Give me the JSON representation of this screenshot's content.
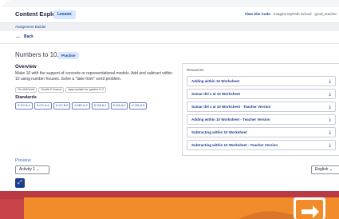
{
  "header": {
    "app_title": "Content Explorer",
    "badge": "Lesson",
    "view_site_code": "View Site Code",
    "school_text": "· Imagine MyPath School · good_teacher"
  },
  "breadcrumb": {
    "label": "Assignment Builder"
  },
  "nav": {
    "back_arrow": "←",
    "back_label": "Back"
  },
  "lesson": {
    "title": "Numbers to 10, I",
    "type_badge": "Practice",
    "overview_heading": "Overview",
    "overview_text": "Make 10 with the support of concrete or representational models. Add and subtract within 10 using number houses. Solve a \"take from\" word problem.",
    "chips": [
      "On skill level",
      "Grade K lesson",
      "Appropriate for grades K-2"
    ],
    "standards_heading": "Standards",
    "standards": [
      "K.CC.A.1",
      "K.CC.A.2",
      "K.CC.B.5",
      "K.MD.A.2",
      "K.OA.A.1",
      "K.OA.A.2",
      "K.OA.A.3"
    ]
  },
  "resources": {
    "heading": "Resources",
    "download_icon": "download-icon",
    "items": [
      "Adding within 10 Worksheet",
      "Sumar del 1 al 10 Worksheet",
      "Sumar del 1 al 10 Worksheet - Teacher Version",
      "Adding within 10 Worksheet - Teacher Version",
      "Subtracting within 10 Worksheet",
      "Subtracting within 10 Worksheet - Teacher Version"
    ]
  },
  "preview": {
    "label": "Preview",
    "activity_select": "Activity 1 ⌄",
    "language_select": "English ⌄",
    "expand_icon": "⤢"
  },
  "colors": {
    "accent": "#1d3d8f",
    "stage_red": "#c8434a",
    "stage_orange": "#f28c2a"
  }
}
